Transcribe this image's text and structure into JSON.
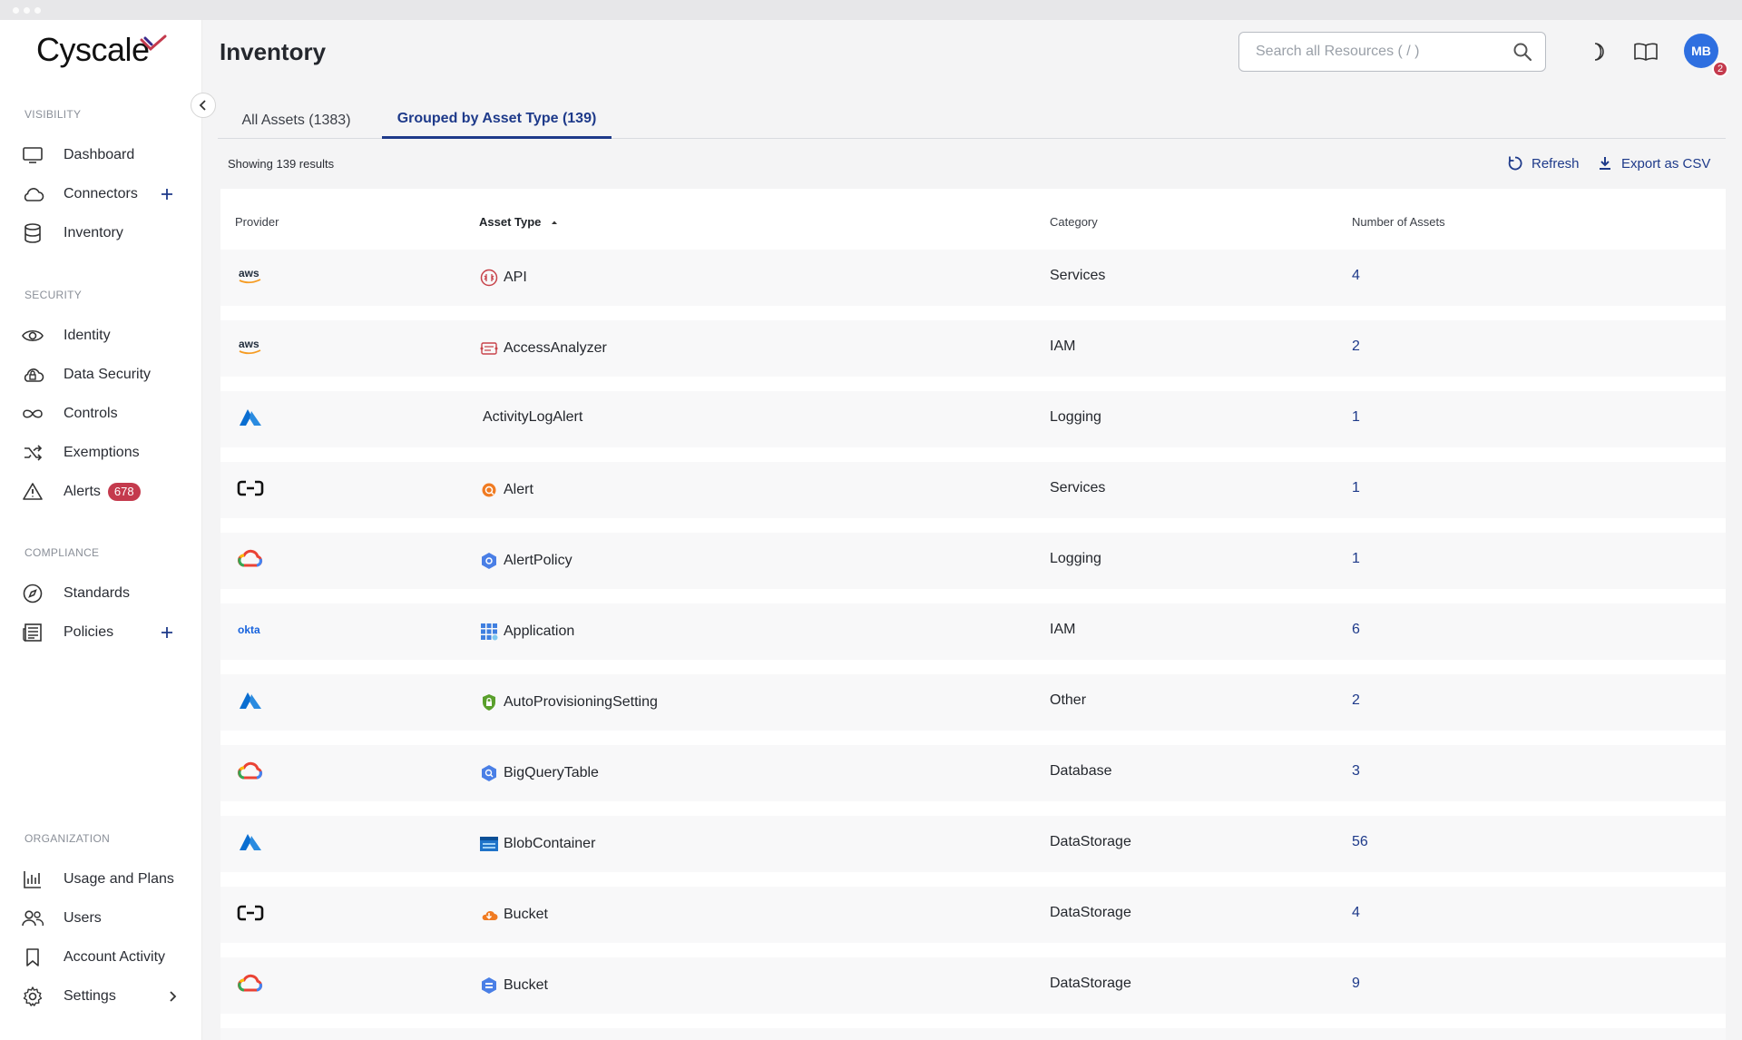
{
  "app": {
    "brand": "Cyscale"
  },
  "sidebar": {
    "sections": [
      {
        "label": "VISIBILITY"
      },
      {
        "label": "SECURITY"
      },
      {
        "label": "COMPLIANCE"
      },
      {
        "label": "ORGANIZATION"
      }
    ],
    "items": [
      {
        "label": "Dashboard",
        "icon": "monitor-icon"
      },
      {
        "label": "Connectors",
        "icon": "cloud-icon"
      },
      {
        "label": "Inventory",
        "icon": "database-icon"
      },
      {
        "label": "Identity",
        "icon": "eye-icon"
      },
      {
        "label": "Data Security",
        "icon": "cloud-lock-icon"
      },
      {
        "label": "Controls",
        "icon": "infinity-icon"
      },
      {
        "label": "Exemptions",
        "icon": "shuffle-icon"
      },
      {
        "label": "Alerts",
        "icon": "warning-icon",
        "badge": "678"
      },
      {
        "label": "Standards",
        "icon": "compass-icon"
      },
      {
        "label": "Policies",
        "icon": "newspaper-icon"
      },
      {
        "label": "Usage and Plans",
        "icon": "bar-chart-icon"
      },
      {
        "label": "Users",
        "icon": "users-icon"
      },
      {
        "label": "Account Activity",
        "icon": "bookmark-icon"
      },
      {
        "label": "Settings",
        "icon": "gear-icon"
      }
    ]
  },
  "header": {
    "title": "Inventory",
    "search_placeholder": "Search all Resources ( / )",
    "avatar_initials": "MB",
    "avatar_badge": "2"
  },
  "tabs": [
    {
      "label": "All Assets (1383)",
      "active": false
    },
    {
      "label": "Grouped by Asset Type (139)",
      "active": true
    }
  ],
  "toolbar": {
    "results_text": "Showing 139 results",
    "refresh_label": "Refresh",
    "export_label": "Export as CSV"
  },
  "table": {
    "headers": {
      "provider": "Provider",
      "asset_type": "Asset Type",
      "category": "Category",
      "count": "Number of Assets"
    },
    "rows": [
      {
        "provider": "aws",
        "asset_type": "API",
        "category": "Services",
        "count": "4"
      },
      {
        "provider": "aws",
        "asset_type": "AccessAnalyzer",
        "category": "IAM",
        "count": "2"
      },
      {
        "provider": "azure",
        "asset_type": "ActivityLogAlert",
        "category": "Logging",
        "count": "1"
      },
      {
        "provider": "alibaba",
        "asset_type": "Alert",
        "category": "Services",
        "count": "1"
      },
      {
        "provider": "gcp",
        "asset_type": "AlertPolicy",
        "category": "Logging",
        "count": "1"
      },
      {
        "provider": "okta",
        "asset_type": "Application",
        "category": "IAM",
        "count": "6"
      },
      {
        "provider": "azure",
        "asset_type": "AutoProvisioningSetting",
        "category": "Other",
        "count": "2"
      },
      {
        "provider": "gcp",
        "asset_type": "BigQueryTable",
        "category": "Database",
        "count": "3"
      },
      {
        "provider": "azure",
        "asset_type": "BlobContainer",
        "category": "DataStorage",
        "count": "56"
      },
      {
        "provider": "alibaba",
        "asset_type": "Bucket",
        "category": "DataStorage",
        "count": "4"
      },
      {
        "provider": "gcp",
        "asset_type": "Bucket",
        "category": "DataStorage",
        "count": "9"
      }
    ]
  },
  "colors": {
    "accent": "#1e3a8a",
    "badge": "#c43a4d",
    "avatar": "#2e6fe0"
  }
}
